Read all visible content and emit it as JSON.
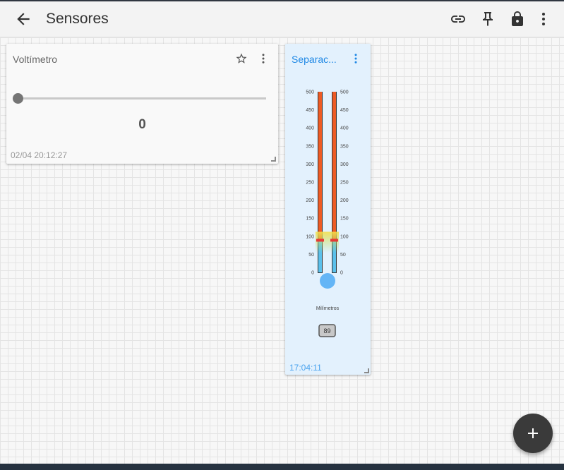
{
  "header": {
    "title": "Sensores",
    "icons": [
      "arrow-back-icon",
      "link-icon",
      "pin-icon",
      "lock-icon",
      "more-vert-icon"
    ]
  },
  "widgets": {
    "voltimetro": {
      "title": "Voltímetro",
      "slider_value": 0,
      "value_display": "0",
      "timestamp": "02/04 20:12:27"
    },
    "separacion": {
      "title": "Separac...",
      "unit_label": "Milímetros",
      "scale_ticks": [
        "500",
        "450",
        "400",
        "350",
        "300",
        "250",
        "200",
        "150",
        "100",
        "50",
        "0"
      ],
      "level_value": 89,
      "value_badge": "89",
      "timestamp": "17:04:11",
      "colors": {
        "high": "#ee5a24",
        "low": "#5bc0eb",
        "bulb": "#64b5f6",
        "mark": "#e53935"
      }
    }
  },
  "colors": {
    "accent": "#1e88e5",
    "fab": "#3a3a3a"
  }
}
